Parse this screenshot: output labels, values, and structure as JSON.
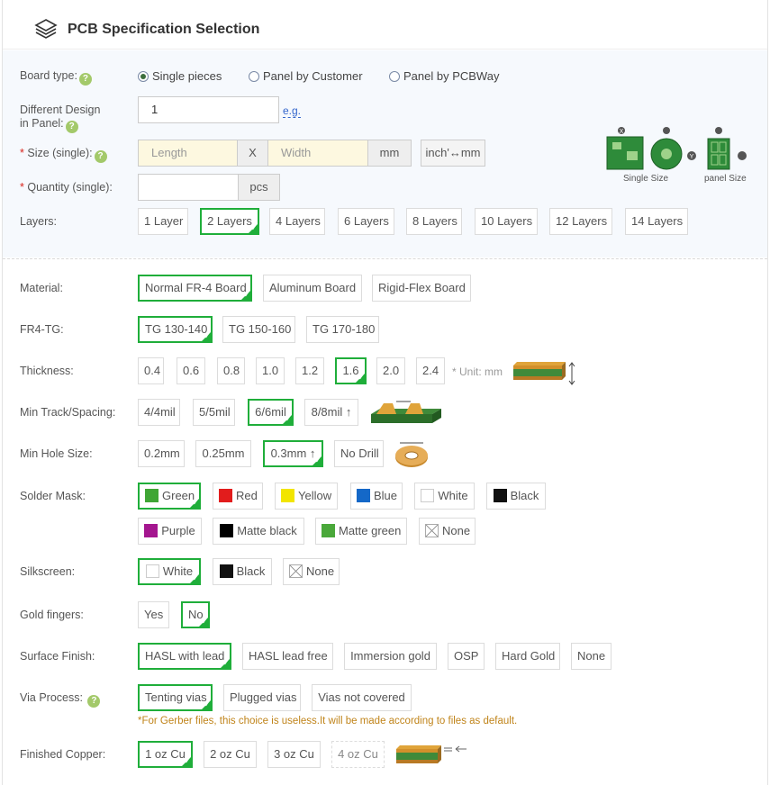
{
  "header": {
    "title": "PCB Specification Selection",
    "logo_icon": "layers-stack-icon"
  },
  "board_type": {
    "label": "Board type:",
    "options": [
      "Single pieces",
      "Panel by Customer",
      "Panel by PCBWay"
    ],
    "selected": "Single pieces"
  },
  "design_in_panel": {
    "label_line1": "Different Design",
    "label_line2": "in Panel:",
    "value": "1",
    "example_link": "e.g."
  },
  "size": {
    "required_mark": "*",
    "label": "Size (single):",
    "length_placeholder": "Length",
    "x_separator": "X",
    "width_placeholder": "Width",
    "unit": "mm",
    "convert_button": "inch'↔mm"
  },
  "quantity": {
    "required_mark": "*",
    "label": "Quantity (single):",
    "value": "",
    "unit": "pcs"
  },
  "size_images": {
    "single_caption": "Single Size",
    "panel_caption": "panel Size",
    "x_mark": "X",
    "y_mark": "Y"
  },
  "layers": {
    "label": "Layers:",
    "options": [
      "1 Layer",
      "2 Layers",
      "4 Layers",
      "6 Layers",
      "8 Layers",
      "10 Layers",
      "12 Layers",
      "14 Layers"
    ],
    "selected": "2 Layers"
  },
  "material": {
    "label": "Material:",
    "options": [
      "Normal FR-4 Board",
      "Aluminum Board",
      "Rigid-Flex Board"
    ],
    "selected": "Normal FR-4 Board"
  },
  "fr4_tg": {
    "label": "FR4-TG:",
    "options": [
      "TG 130-140",
      "TG 150-160",
      "TG 170-180"
    ],
    "selected": "TG 130-140"
  },
  "thickness": {
    "label": "Thickness:",
    "options": [
      "0.4",
      "0.6",
      "0.8",
      "1.0",
      "1.2",
      "1.6",
      "2.0",
      "2.4"
    ],
    "selected": "1.6",
    "unit_note": "* Unit: mm"
  },
  "min_track": {
    "label": "Min Track/Spacing:",
    "options": [
      "4/4mil",
      "5/5mil",
      "6/6mil",
      "8/8mil ↑"
    ],
    "selected": "6/6mil"
  },
  "min_hole": {
    "label": "Min Hole Size:",
    "options": [
      "0.2mm",
      "0.25mm",
      "0.3mm ↑",
      "No Drill"
    ],
    "selected": "0.3mm ↑"
  },
  "solder_mask": {
    "label": "Solder Mask:",
    "options": [
      {
        "name": "Green",
        "color": "#3fa535"
      },
      {
        "name": "Red",
        "color": "#e21c1c"
      },
      {
        "name": "Yellow",
        "color": "#f2e500"
      },
      {
        "name": "Blue",
        "color": "#1468c8"
      },
      {
        "name": "White",
        "color": "#ffffff"
      },
      {
        "name": "Black",
        "color": "#111111"
      },
      {
        "name": "Purple",
        "color": "#a4168f"
      },
      {
        "name": "Matte black",
        "color": "#000000"
      },
      {
        "name": "Matte green",
        "color": "#4aa83a"
      },
      {
        "name": "None",
        "color": "none"
      }
    ],
    "selected": "Green"
  },
  "silkscreen": {
    "label": "Silkscreen:",
    "options": [
      {
        "name": "White",
        "color": "#ffffff"
      },
      {
        "name": "Black",
        "color": "#111111"
      },
      {
        "name": "None",
        "color": "none"
      }
    ],
    "selected": "White"
  },
  "gold_fingers": {
    "label": "Gold fingers:",
    "options": [
      "Yes",
      "No"
    ],
    "selected": "No"
  },
  "surface_finish": {
    "label": "Surface Finish:",
    "options": [
      "HASL with lead",
      "HASL lead free",
      "Immersion gold",
      "OSP",
      "Hard Gold",
      "None"
    ],
    "selected": "HASL with lead"
  },
  "via_process": {
    "label": "Via Process:",
    "options": [
      "Tenting vias",
      "Plugged vias",
      "Vias not covered"
    ],
    "selected": "Tenting vias",
    "note": "*For Gerber files, this choice is useless.It will be made according to files as default."
  },
  "finished_copper": {
    "label": "Finished Copper:",
    "options": [
      "1 oz Cu",
      "2 oz Cu",
      "3 oz Cu",
      "4 oz Cu"
    ],
    "selected": "1 oz Cu"
  },
  "colors": {
    "accent": "#1fae3a",
    "help": "#a3c96a",
    "required": "#d9251d",
    "note": "#c0841a",
    "link": "#3366cc"
  }
}
